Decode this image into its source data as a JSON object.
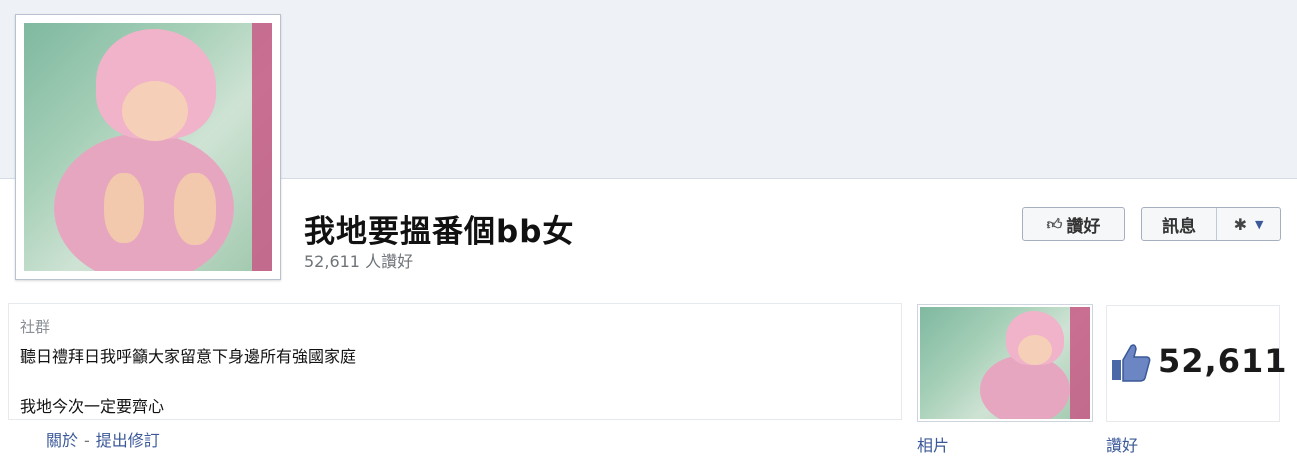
{
  "page": {
    "name": "我地要搵番個bb女",
    "likes_line": "52,611 人讚好"
  },
  "actions": {
    "like_label": "讚好",
    "message_label": "訊息",
    "settings_icon": "gear-icon",
    "dropdown_icon": "chevron-down-icon"
  },
  "about": {
    "category": "社群",
    "line1": "聽日禮拜日我呼籲大家留意下身邊所有強國家庭",
    "line2": "我地今次一定要齊心",
    "link_about": "關於",
    "separator": "-",
    "link_edit": "提出修訂"
  },
  "tiles": {
    "photos_label": "相片",
    "likes_label": "讚好",
    "likes_count": "52,611"
  },
  "colors": {
    "link": "#3b5998",
    "cover": "#eef1f5"
  }
}
